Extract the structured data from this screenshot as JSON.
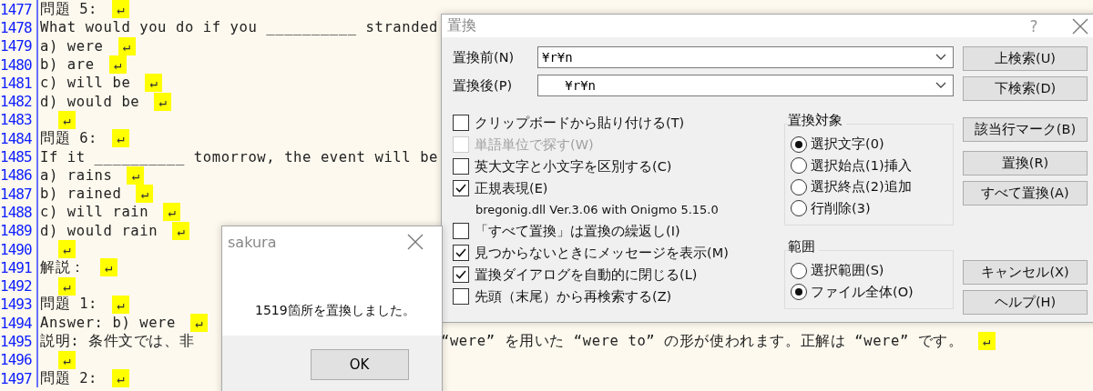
{
  "editor": {
    "lines": [
      {
        "number": "1477",
        "text": "問題 5:",
        "eol": "↵"
      },
      {
        "number": "1478",
        "text": "What would you do if you __________ stranded"
      },
      {
        "number": "1479",
        "text": "a) were",
        "eol": "↵"
      },
      {
        "number": "1480",
        "text": "b) are",
        "eol": "↵"
      },
      {
        "number": "1481",
        "text": "c) will be",
        "eol": "↵"
      },
      {
        "number": "1482",
        "text": "d) would be",
        "eol": "↵"
      },
      {
        "number": "1483",
        "eol": "↵"
      },
      {
        "number": "1484",
        "text": "問題 6:",
        "eol": "↵"
      },
      {
        "number": "1485",
        "text": "If it __________ tomorrow, the event will be"
      },
      {
        "number": "1486",
        "text": "a) rains",
        "eol": "↵"
      },
      {
        "number": "1487",
        "text": "b) rained",
        "eol": "↵"
      },
      {
        "number": "1488",
        "text": "c) will rain",
        "eol": "↵"
      },
      {
        "number": "1489",
        "text": "d) would rain",
        "eol": "↵"
      },
      {
        "number": "1490",
        "eol": "↵"
      },
      {
        "number": "1491",
        "text": "解説：",
        "eol": "↵"
      },
      {
        "number": "1492",
        "eol": "↵"
      },
      {
        "number": "1493",
        "text": "問題 1:",
        "eol": "↵"
      },
      {
        "number": "1494",
        "text": "Answer: b) were",
        "eol": "↵"
      },
      {
        "number": "1495",
        "text": "説明: 条件文では、非",
        "text_2": "“were” を用いた “were to” の形が使われます。正解は “were” です。",
        "eol": "↵"
      },
      {
        "number": "1496",
        "eol": "↵"
      },
      {
        "number": "1497",
        "text": "問題 2:",
        "eol": "↵"
      }
    ]
  },
  "replace_dialog": {
    "title": "置換",
    "help": "?",
    "fields": [
      {
        "label": "置換前(N)",
        "value": "¥r¥n"
      },
      {
        "label": "置換後(P)",
        "value": "   ¥r¥n"
      }
    ],
    "options": [
      {
        "kind": "checkbox",
        "label": "クリップボードから貼り付ける(T)",
        "checked": false,
        "disabled": false
      },
      {
        "kind": "checkbox",
        "label": "単語単位で探す(W)",
        "checked": false,
        "disabled": true
      },
      {
        "kind": "checkbox",
        "label": "英大文字と小文字を区別する(C)",
        "checked": false,
        "disabled": false
      },
      {
        "kind": "checkbox",
        "label": "正規表現(E)",
        "checked": true,
        "disabled": false
      },
      {
        "kind": "note",
        "label": "bregonig.dll Ver.3.06 with Onigmo 5.15.0"
      },
      {
        "kind": "checkbox",
        "label": "「すべて置換」は置換の繰返し(I)",
        "checked": false,
        "disabled": false
      },
      {
        "kind": "checkbox",
        "label": "見つからないときにメッセージを表示(M)",
        "checked": true,
        "disabled": false
      },
      {
        "kind": "checkbox",
        "label": "置換ダイアログを自動的に閉じる(L)",
        "checked": true,
        "disabled": false
      },
      {
        "kind": "checkbox",
        "label": "先頭（末尾）から再検索する(Z)",
        "checked": false,
        "disabled": false
      }
    ],
    "groups": [
      {
        "title": "置換対象",
        "options": [
          {
            "label": "選択文字(0)",
            "selected": true
          },
          {
            "label": "選択始点(1)挿入",
            "selected": false
          },
          {
            "label": "選択終点(2)追加",
            "selected": false
          },
          {
            "label": "行削除(3)",
            "selected": false
          }
        ]
      },
      {
        "title": "範囲",
        "options": [
          {
            "label": "選択範囲(S)",
            "selected": false
          },
          {
            "label": "ファイル全体(O)",
            "selected": true
          }
        ]
      }
    ],
    "button_groups": [
      [
        "上検索(U)",
        "下検索(D)"
      ],
      [
        "該当行マーク(B)"
      ],
      [
        "置換(R)",
        "すべて置換(A)"
      ],
      [
        "キャンセル(X)",
        "ヘルプ(H)"
      ]
    ]
  },
  "message_box": {
    "title": "sakura",
    "message": "1519箇所を置換しました。",
    "button": "OK"
  }
}
